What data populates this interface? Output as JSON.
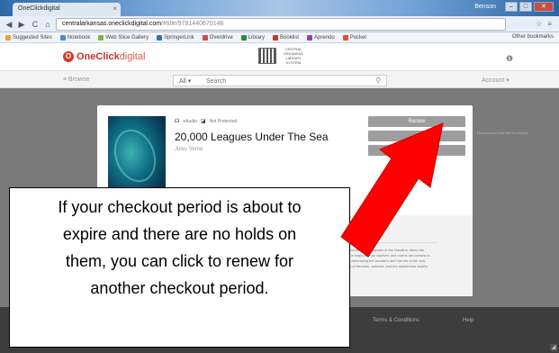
{
  "browser": {
    "tab_title": "OneClickdigital",
    "user_label": "Benson",
    "url_host": "centralarkansas.oneclickdigital.com",
    "url_path": "/#title/9781440670146",
    "bookmarks": [
      "Suggested Sites",
      "Notebook",
      "Web Slice Gallery",
      "SpringerLink",
      "Overdrive",
      "Library",
      "Booklist",
      "Aprendo",
      "Pocket"
    ],
    "other_bookmarks": "Other bookmarks",
    "colors": {
      "titlebar": "#2f69a8",
      "close_button": "#c84f3e"
    }
  },
  "site": {
    "logo_text_bold": "OneClick",
    "logo_text_light": "digital",
    "library_name": "CENTRAL ARKANSAS LIBRARY SYSTEM",
    "browse_label": "≡ Browse",
    "search_scope": "All ▾",
    "search_placeholder": "Search",
    "account_label": "Account ▾",
    "colors": {
      "brand": "#c8352a"
    }
  },
  "modal": {
    "formats": [
      "eAudio",
      "Not Protected"
    ],
    "title": "20,000 Leagues Under The Sea",
    "author": "Jules Verne",
    "buttons": [
      "Renew",
      "",
      "▾"
    ],
    "description": "Nemo, the cold, brilliant, and rebellious captain of the Nautilus, takes the professor, his servant and a harpooner as captives and roams the oceans in the marvelous submarine, witnessing the wonders and horrors of the sea. The book explores themes of freedom, science, and the mysterious depths of the seas.",
    "side_link": "Recommend this title to a friend"
  },
  "footer": {
    "terms": "Terms & Conditions",
    "help": "Help"
  },
  "annotation": {
    "text": "If your checkout period is about to\nexpire and there are no holds on\nthem, you can click to renew for\nanother checkout period.",
    "arrow_color": "#ff0000"
  }
}
